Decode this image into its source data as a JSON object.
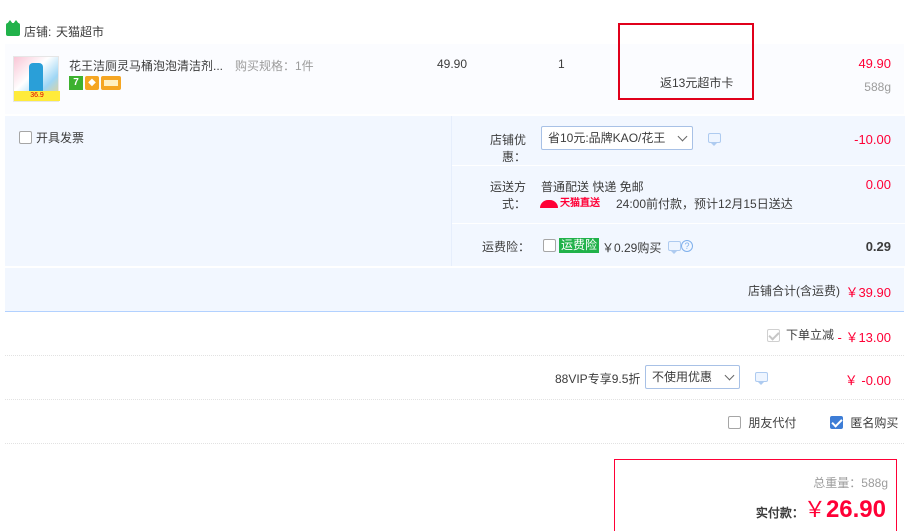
{
  "shop": {
    "label": "店铺:",
    "name": "天猫超市"
  },
  "item": {
    "title": "花王洁厕灵马桶泡泡清洁剂...",
    "spec": "购买规格：1件",
    "thumb_price": "36.9",
    "badges": [
      "7",
      "",
      ""
    ],
    "unit_price": "49.90",
    "quantity": "1",
    "rebate": "返13元超市卡",
    "total": "49.90",
    "weight": "588g"
  },
  "invoice": {
    "label": "开具发票",
    "checked": false
  },
  "shop_discount": {
    "label": "店铺优惠：",
    "selected": "省10元:品牌KAO/花王",
    "amount": "-10.00"
  },
  "shipping": {
    "label": "运送方式：",
    "method": "普通配送 快递 免邮",
    "logo_text": "天猫直送",
    "eta": "24:00前付款，预计12月15日送达",
    "amount": "0.00"
  },
  "insurance": {
    "label": "运费险：",
    "tag": "运费险",
    "price_text": "￥0.29购买",
    "amount": "0.29"
  },
  "subtotal": {
    "label": "店铺合计(含运费)",
    "amount": "￥39.90"
  },
  "instant_cut": {
    "label": "下单立减",
    "amount": "- ￥13.00"
  },
  "vip": {
    "label": "88VIP专享9.5折",
    "selected": "不使用优惠",
    "amount": "￥ -0.00"
  },
  "pay_options": {
    "friend_pay": "朋友代付",
    "anonymous": "匿名购买"
  },
  "final": {
    "weight_text": "总重量：588g",
    "pay_label": "实付款：",
    "currency": "￥",
    "amount": "26.90"
  },
  "colors": {
    "accent_red": "#ff0036",
    "highlight_box": "#e0001b",
    "panel_bg": "#f2f7ff",
    "tmall_green": "#21b24a"
  },
  "icons": [
    "tmall-shop-icon",
    "message-icon",
    "help-icon",
    "chevron-down-icon",
    "tmall-direct-logo"
  ]
}
